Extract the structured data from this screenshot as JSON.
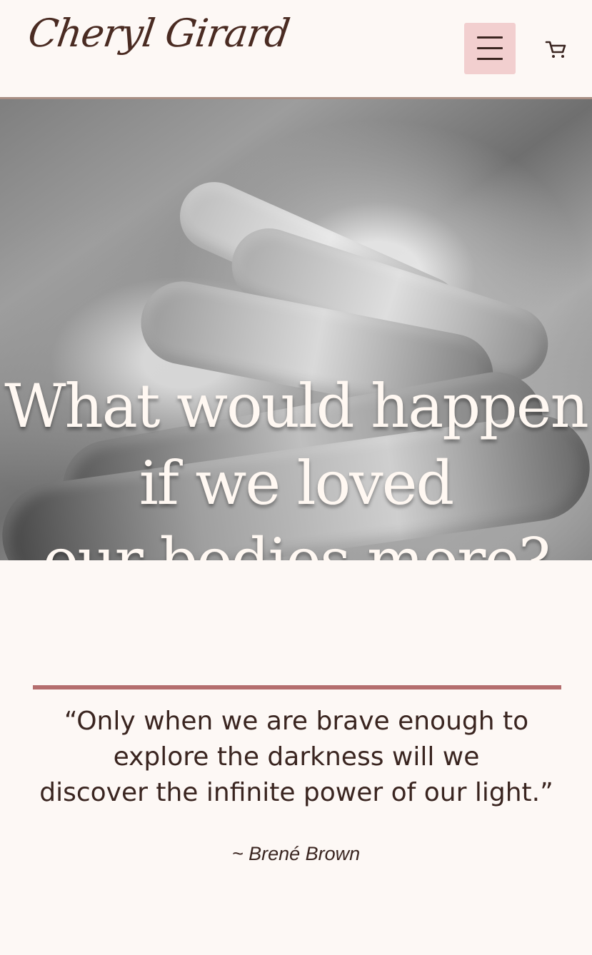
{
  "header": {
    "logo": "Cheryl Girard",
    "menu_icon": "hamburger-menu-icon",
    "cart_icon": "shopping-cart-icon"
  },
  "hero": {
    "title_line_1": "What would happen",
    "title_line_2": "if we loved",
    "title_line_3": "our bodies more?"
  },
  "quote": {
    "text_line_1": "“Only when we are brave enough to",
    "text_line_2": "explore the darkness will we",
    "text_line_3": "discover the infinite power of our light.”",
    "author": "~ Brené Brown"
  },
  "colors": {
    "background": "#fdf8f5",
    "menu_button": "#f2cfcf",
    "accent_rule": "#b56e6e",
    "text": "#3a2520"
  }
}
